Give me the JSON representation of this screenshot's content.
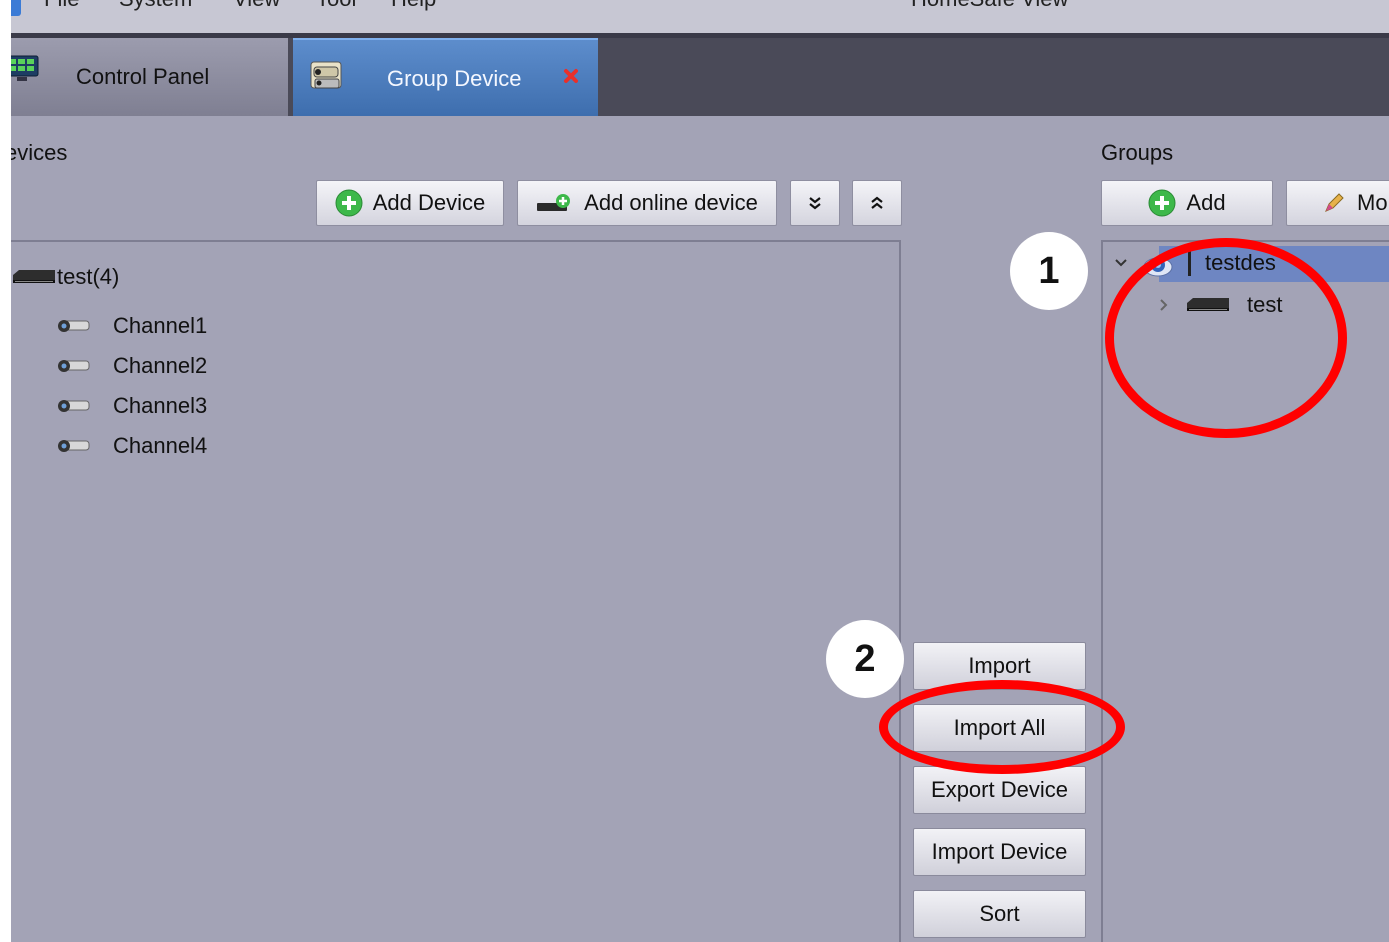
{
  "window": {
    "menu": [
      "File",
      "System",
      "View",
      "Tool",
      "Help"
    ],
    "title": "HomeSafe View"
  },
  "tabs": [
    {
      "label": "Control Panel",
      "icon": "control-panel-icon"
    },
    {
      "label": "Group Device",
      "icon": "camera-group-icon",
      "active": true
    }
  ],
  "devices": {
    "title": "evices",
    "toolbar": {
      "add_device": "Add Device",
      "add_online_device": "Add online device",
      "expand_all": "≫",
      "collapse_all": "≪"
    },
    "tree": {
      "root_label": "test(4)",
      "channels": [
        "Channel1",
        "Channel2",
        "Channel3",
        "Channel4"
      ]
    }
  },
  "middle_buttons": {
    "import": "Import",
    "import_all": "Import All",
    "export_device": "Export Device",
    "import_device": "Import Device",
    "sort": "Sort"
  },
  "groups": {
    "title": "Groups",
    "toolbar": {
      "add": "Add",
      "modify": "Mo"
    },
    "tree": {
      "group_label": "testdes",
      "device_label": "test"
    }
  },
  "annotations": {
    "badge_1": "1",
    "badge_2": "2",
    "ring_color": "#ff0000"
  }
}
